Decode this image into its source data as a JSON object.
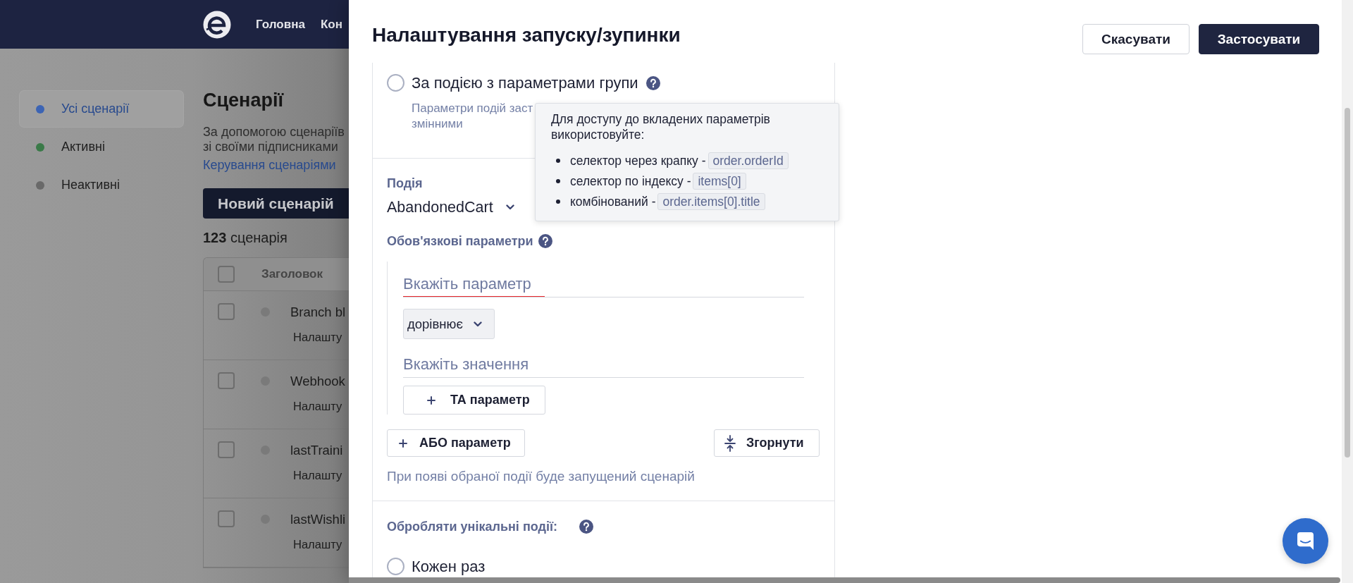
{
  "top_nav": {
    "items": [
      {
        "label": "Головна"
      },
      {
        "label": "Кон"
      }
    ]
  },
  "sidebar": {
    "items": [
      {
        "label": "Усі сценарії",
        "selected": true,
        "color": "#3c64b4"
      },
      {
        "label": "Активні",
        "selected": false,
        "color": "#3a7a48"
      },
      {
        "label": "Неактивні",
        "selected": false,
        "color": "#696969"
      }
    ]
  },
  "scenarios": {
    "title": "Сценарії",
    "description": "За допомогою сценаріїв\nзі своїми підписниками",
    "link": "Керування сценаріями",
    "new_button": "Новий сценарій",
    "count": "**123** сценарія"
  },
  "table": {
    "columns": [
      "Заголовок"
    ],
    "header_checked": false,
    "rows": [
      {
        "title": "Branch bl",
        "subtitle": "Налашту",
        "checked": false,
        "active": false
      },
      {
        "title": "Webhook",
        "subtitle": "Налашту",
        "checked": false,
        "active": false
      },
      {
        "title": "lastTraini",
        "subtitle": "Налашту",
        "checked": false,
        "active": false
      },
      {
        "title": "lastWishli",
        "subtitle": "Налашту",
        "checked": false,
        "active": false
      }
    ]
  },
  "modal": {
    "title": "Налаштування запуску/зупинки",
    "buttons": [
      {
        "label": "Скасувати",
        "kind": "secondary"
      },
      {
        "label": "Застосувати",
        "kind": "primary"
      }
    ],
    "trigger": {
      "label": "За подією з параметрами групи",
      "selected": false,
      "description": "Параметри подій заст\nзмінними"
    },
    "event": {
      "label": "Подія",
      "value": "AbandonedCart"
    },
    "required_params": {
      "label": "Обов'язкові параметри",
      "conditions": [
        {
          "param_placeholder": "Вкажіть параметр",
          "error": true,
          "operator": "дорівнює",
          "value_placeholder": "Вкажіть значення"
        }
      ],
      "and_button": "ТА параметр",
      "or_button": "АБО параметр",
      "collapse_button": "Згорнути",
      "hint": "При появі обраної події буде запущений сценарій"
    },
    "unique_events": {
      "label": "Обробляти унікальні події:",
      "options": [
        {
          "label": "Кожен раз",
          "selected": false
        }
      ]
    },
    "tooltip": {
      "intro": "Для доступу до вкладених параметрів використовуйте:",
      "items": [
        {
          "text": "селектор через крапку -",
          "code": "order.orderId"
        },
        {
          "text": "селектор по індексу -",
          "code": "items[0]"
        },
        {
          "text": "комбінований -",
          "code": "order.items[0].title"
        }
      ]
    }
  }
}
